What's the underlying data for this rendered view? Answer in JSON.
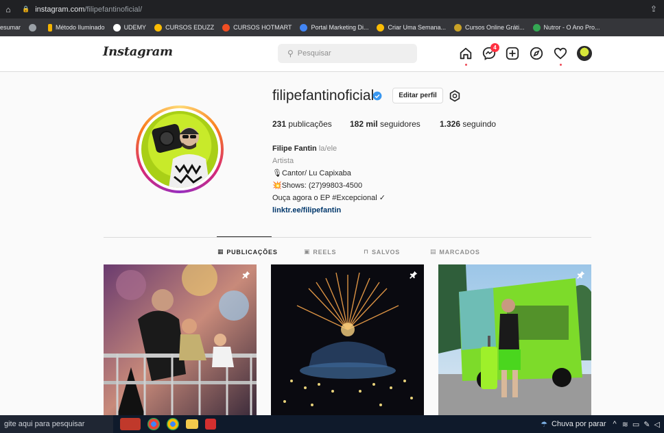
{
  "browser": {
    "url_host": "instagram.com",
    "url_path": "/filipefantinoficial/"
  },
  "bookmarks": [
    {
      "label": "esumar",
      "color": "#35363a"
    },
    {
      "label": "",
      "color": "#9aa0a6"
    },
    {
      "label": "Método Iluminado",
      "color": "#f4b400"
    },
    {
      "label": "UDEMY",
      "color": "#ffffff"
    },
    {
      "label": "CURSOS EDUZZ",
      "color": "#fbbc04"
    },
    {
      "label": "CURSOS HOTMART",
      "color": "#f04e23"
    },
    {
      "label": "Portal Marketing Di...",
      "color": "#4285f4"
    },
    {
      "label": "Criar Uma Semana...",
      "color": "#fbbc04"
    },
    {
      "label": "Cursos Online Gráti...",
      "color": "#c9a227"
    },
    {
      "label": "Nutror - O Ano Pro...",
      "color": "#34a853"
    }
  ],
  "nav": {
    "logo": "Instagram",
    "search_placeholder": "Pesquisar",
    "messages_badge": "4"
  },
  "profile": {
    "username": "filipefantinoficial",
    "edit_button": "Editar perfil",
    "posts_count": "231",
    "posts_label": "publicações",
    "followers_count": "182 mil",
    "followers_label": "seguidores",
    "following_count": "1.326",
    "following_label": "seguindo",
    "full_name": "Filipe Fantin",
    "pronouns": "la/ele",
    "category": "Artista",
    "bio_line1": "🎙Cantor/ Lu Capixaba",
    "bio_line2": "💥Shows: (27)99803-4500",
    "bio_line3": "Ouça agora o EP #Excepcional ✓",
    "link": "linktr.ee/filipefantin"
  },
  "tabs": [
    {
      "label": "PUBLICAÇÕES",
      "icon": "grid-icon"
    },
    {
      "label": "REELS",
      "icon": "reels-icon"
    },
    {
      "label": "SALVOS",
      "icon": "bookmark-icon"
    },
    {
      "label": "MARCADOS",
      "icon": "tag-icon"
    }
  ],
  "taskbar": {
    "search_text": "gite aqui para pesquisar",
    "weather": "Chuva por parar"
  }
}
